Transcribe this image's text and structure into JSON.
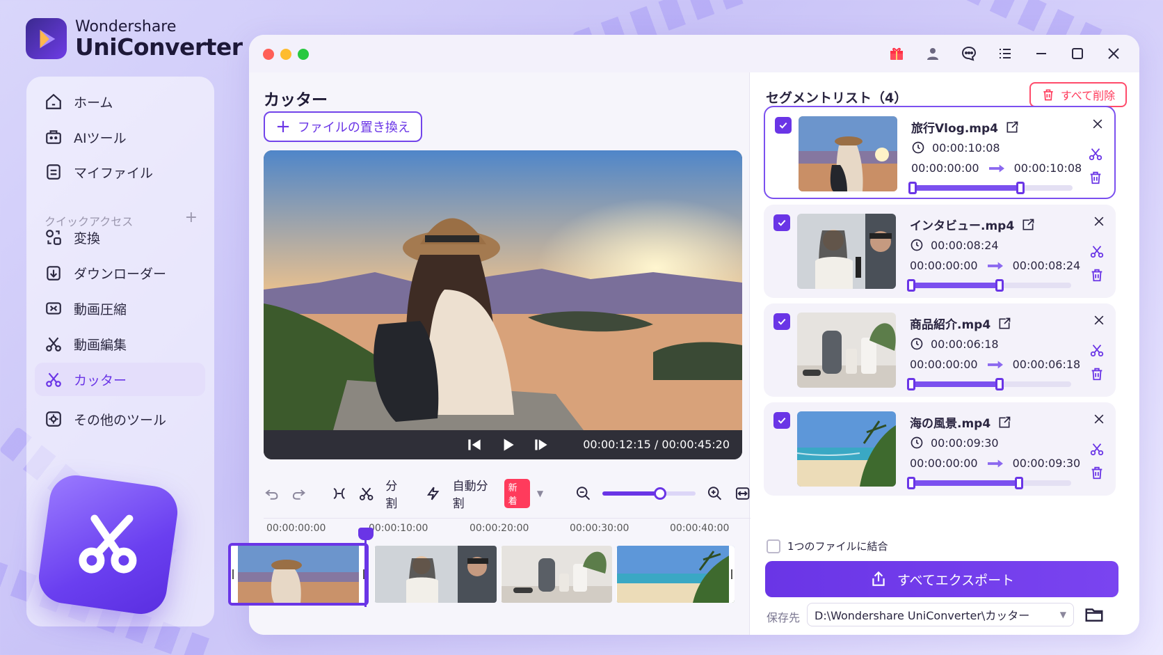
{
  "brand": {
    "line1": "Wondershare",
    "line2": "UniConverter"
  },
  "sidebar": {
    "items": [
      {
        "label": "ホーム",
        "icon": "home-icon"
      },
      {
        "label": "AIツール",
        "icon": "ai-toolbox-icon"
      },
      {
        "label": "マイファイル",
        "icon": "my-files-icon"
      }
    ],
    "quick_access_label": "クイックアクセス",
    "quick_items": [
      {
        "label": "変換",
        "icon": "convert-icon"
      },
      {
        "label": "ダウンローダー",
        "icon": "downloader-icon"
      },
      {
        "label": "動画圧縮",
        "icon": "compress-icon"
      },
      {
        "label": "動画編集",
        "icon": "video-edit-icon"
      },
      {
        "label": "カッター",
        "icon": "cutter-icon",
        "active": true
      },
      {
        "label": "その他のツール",
        "icon": "more-tools-icon"
      }
    ]
  },
  "main": {
    "title": "カッター",
    "replace_label": "ファイルの置き換え",
    "timecode": "00:00:12:15 / 00:00:45:20",
    "toolbar": {
      "split_label": "分割",
      "auto_split_label": "自動分割",
      "new_badge": "新着",
      "zoom_level": 0.6
    },
    "ruler": [
      "00:00:00:00",
      "00:00:10:00",
      "00:00:20:00",
      "00:00:30:00",
      "00:00:40:00"
    ]
  },
  "segments": {
    "title": "セグメントリスト（4）",
    "delete_all_label": "すべて削除",
    "items": [
      {
        "name": "旅行Vlog.mp4",
        "duration": "00:00:10:08",
        "start": "00:00:00:00",
        "end": "00:00:10:08",
        "range": [
          0.0,
          0.7
        ]
      },
      {
        "name": "インタビュー.mp4",
        "duration": "00:00:08:24",
        "start": "00:00:00:00",
        "end": "00:00:08:24",
        "range": [
          0.0,
          0.57
        ]
      },
      {
        "name": "商品紹介.mp4",
        "duration": "00:00:06:18",
        "start": "00:00:00:00",
        "end": "00:00:06:18",
        "range": [
          0.0,
          0.57
        ]
      },
      {
        "name": "海の風景.mp4",
        "duration": "00:00:09:30",
        "start": "00:00:00:00",
        "end": "00:00:09:30",
        "range": [
          0.0,
          0.7
        ]
      }
    ],
    "merge_label": "1つのファイルに結合",
    "export_label": "すべてエクスポート",
    "save_label": "保存先",
    "save_path": "D:\\Wondershare UniConverter\\カッター"
  },
  "colors": {
    "accent": "#6a35e6",
    "danger": "#ff3b5c"
  }
}
